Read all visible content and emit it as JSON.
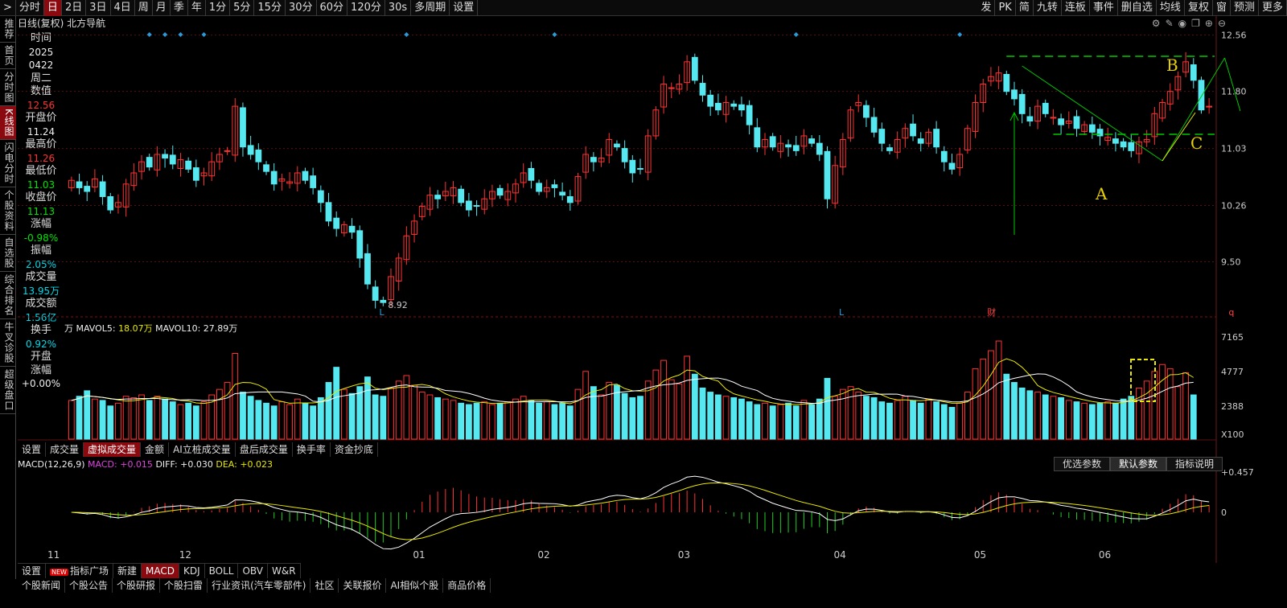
{
  "toolbar": {
    "items": [
      ">",
      "分时",
      "日",
      "2日",
      "3日",
      "4日",
      "周",
      "月",
      "季",
      "年",
      "1分",
      "5分",
      "15分",
      "30分",
      "60分",
      "120分",
      "30s",
      "多周期",
      "设置"
    ],
    "selected": "日",
    "right": [
      "发",
      "PK",
      "简",
      "九转",
      "连板",
      "事件",
      "删自选",
      "均线",
      "复权",
      "窗",
      "预测",
      "更多"
    ]
  },
  "sidebar": [
    "推荐",
    "首页",
    "分时图",
    "K线图",
    "闪电分时",
    "个股资料",
    "自选股",
    "综合排名",
    "牛叉诊股",
    "超级盘口"
  ],
  "sidebar_selected": "K线图",
  "chart_header": "日线(复权) 北方导航",
  "info": [
    {
      "label": "时间",
      "value": "2025",
      "cls": "wht"
    },
    {
      "label": "",
      "value": "0422",
      "cls": "wht"
    },
    {
      "label": "周二",
      "value": "",
      "cls": "wht"
    },
    {
      "label": "数值",
      "value": "12.56",
      "cls": "red"
    },
    {
      "label": "开盘价",
      "value": "11.24",
      "cls": "wht"
    },
    {
      "label": "最高价",
      "value": "11.26",
      "cls": "red"
    },
    {
      "label": "最低价",
      "value": "11.03",
      "cls": "grn"
    },
    {
      "label": "收盘价",
      "value": "11.13",
      "cls": "grn"
    },
    {
      "label": "涨幅",
      "value": "-0.98%",
      "cls": "grn"
    },
    {
      "label": "振幅",
      "value": "2.05%",
      "cls": "cyn"
    },
    {
      "label": "成交量",
      "value": "13.95万",
      "cls": "cyn"
    },
    {
      "label": "成交额",
      "value": "1.56亿",
      "cls": "cyn"
    },
    {
      "label": "换手",
      "value": "0.92%",
      "cls": "cyn"
    },
    {
      "label": "开盘",
      "value": "",
      "cls": "wht"
    },
    {
      "label": "涨幅",
      "value": "+0.00%",
      "cls": "wht"
    }
  ],
  "price_axis": [
    "12.56",
    "11.80",
    "11.03",
    "10.26",
    "9.50"
  ],
  "low_label": "8.92",
  "markers": {
    "l1": "L",
    "l2": "L",
    "cai": "财",
    "q": "q"
  },
  "annotations": {
    "A": "A",
    "B": "B",
    "C": "C"
  },
  "volume": {
    "unit": "万",
    "mavol5_label": "MAVOL5:",
    "mavol5": "18.07万",
    "mavol10_label": "MAVOL10:",
    "mavol10": "27.89万",
    "axis": [
      "7165",
      "4777",
      "2388",
      "X100"
    ]
  },
  "subtabs": [
    "设置",
    "成交量",
    "虚拟成交量",
    "金额",
    "AI立桩成交量",
    "盘后成交量",
    "换手率",
    "资金抄底"
  ],
  "subtab_selected": "虚拟成交量",
  "macd": {
    "title": "MACD(12,26,9)",
    "macd": "MACD: +0.015",
    "diff": "DIFF: +0.030",
    "dea": "DEA: +0.023",
    "axis": [
      "+0.457",
      "0"
    ]
  },
  "macd_buttons": [
    "优选参数",
    "默认参数",
    "指标说明"
  ],
  "months": [
    "11",
    "12",
    "01",
    "02",
    "03",
    "04",
    "05",
    "06"
  ],
  "bottom_tabs": [
    "设置",
    "指标广场",
    "新建",
    "MACD",
    "KDJ",
    "BOLL",
    "OBV",
    "W&R"
  ],
  "bottom_selected": "MACD",
  "footer": [
    "个股新闻",
    "个股公告",
    "个股研报",
    "个股扫雷",
    "行业资讯(汽车零部件)",
    "社区",
    "关联报价",
    "AI相似个股",
    "商品价格"
  ],
  "colors": {
    "up": "#ff3232",
    "down": "#55e8f0",
    "ma5": "#ffffff",
    "ma10": "#e8e800",
    "accent": "#8b0a10",
    "trend": "#00c800"
  },
  "chart_data": {
    "type": "candlestick",
    "price_range": [
      8.8,
      12.6
    ],
    "close": [
      10.6,
      10.5,
      10.45,
      10.62,
      10.38,
      10.2,
      10.3,
      10.55,
      10.7,
      10.85,
      10.78,
      10.95,
      10.9,
      10.82,
      10.88,
      10.75,
      10.6,
      10.7,
      10.85,
      10.95,
      11.0,
      11.6,
      11.05,
      10.95,
      10.85,
      10.72,
      10.55,
      10.62,
      10.58,
      10.7,
      10.6,
      10.5,
      10.3,
      10.05,
      9.95,
      10.0,
      9.9,
      9.55,
      9.2,
      8.98,
      8.95,
      9.3,
      9.55,
      9.85,
      10.05,
      10.25,
      10.4,
      10.35,
      10.45,
      10.5,
      10.3,
      10.2,
      10.25,
      10.35,
      10.45,
      10.4,
      10.45,
      10.55,
      10.7,
      10.6,
      10.45,
      10.5,
      10.5,
      10.4,
      10.3,
      10.65,
      10.95,
      10.85,
      10.9,
      11.15,
      11.05,
      10.85,
      10.7,
      10.75,
      11.2,
      11.55,
      11.9,
      11.85,
      11.9,
      12.2,
      11.95,
      11.75,
      11.6,
      11.55,
      11.65,
      11.6,
      11.55,
      11.35,
      11.05,
      11.15,
      11.05,
      11.1,
      11.05,
      11.0,
      11.2,
      11.1,
      10.95,
      10.35,
      10.8,
      11.15,
      11.55,
      11.65,
      11.45,
      11.25,
      11.1,
      11.0,
      11.15,
      11.3,
      11.2,
      11.1,
      11.25,
      11.05,
      10.85,
      10.75,
      10.95,
      11.3,
      11.65,
      11.9,
      12.0,
      12.05,
      11.8,
      11.7,
      11.5,
      11.4,
      11.6,
      11.5,
      11.45,
      11.35,
      11.4,
      11.3,
      11.35,
      11.25,
      11.2,
      11.18,
      11.1,
      11.05,
      11.0,
      11.12,
      11.15,
      11.5,
      11.65,
      11.8,
      12.0,
      12.2,
      11.95,
      11.55,
      11.6
    ],
    "volume_x100": [
      2800,
      3100,
      3500,
      2900,
      2800,
      2400,
      2600,
      3100,
      3000,
      3200,
      2800,
      3100,
      2900,
      2700,
      2500,
      2600,
      2400,
      2700,
      3200,
      3600,
      4100,
      6200,
      3400,
      3100,
      2800,
      2600,
      2400,
      2700,
      2500,
      2900,
      2600,
      2400,
      3000,
      4100,
      5200,
      3600,
      3300,
      3800,
      4500,
      3200,
      3100,
      3700,
      4200,
      4600,
      3900,
      3400,
      3200,
      3000,
      2900,
      2800,
      2600,
      2500,
      2600,
      2700,
      2500,
      2600,
      2700,
      2900,
      3100,
      2800,
      2600,
      2700,
      2500,
      2600,
      2400,
      3600,
      4900,
      3800,
      3200,
      4100,
      3900,
      3300,
      3000,
      3100,
      4200,
      5000,
      5700,
      4300,
      4000,
      6000,
      4700,
      3700,
      3400,
      3200,
      3100,
      3000,
      2900,
      2700,
      2500,
      2600,
      2400,
      2500,
      2600,
      2400,
      2800,
      2500,
      2900,
      4400,
      3100,
      3600,
      3800,
      3400,
      3100,
      3000,
      2700,
      2600,
      2800,
      3100,
      2800,
      2600,
      2900,
      2700,
      2500,
      2300,
      2600,
      3400,
      5100,
      5800,
      6400,
      7100,
      4700,
      4100,
      3700,
      3500,
      3400,
      3200,
      3100,
      3000,
      2800,
      2700,
      2600,
      2500,
      2600,
      2700,
      2600,
      2900,
      3100,
      3700,
      4200,
      4900,
      5400,
      5100,
      3800,
      4800,
      3200
    ]
  }
}
